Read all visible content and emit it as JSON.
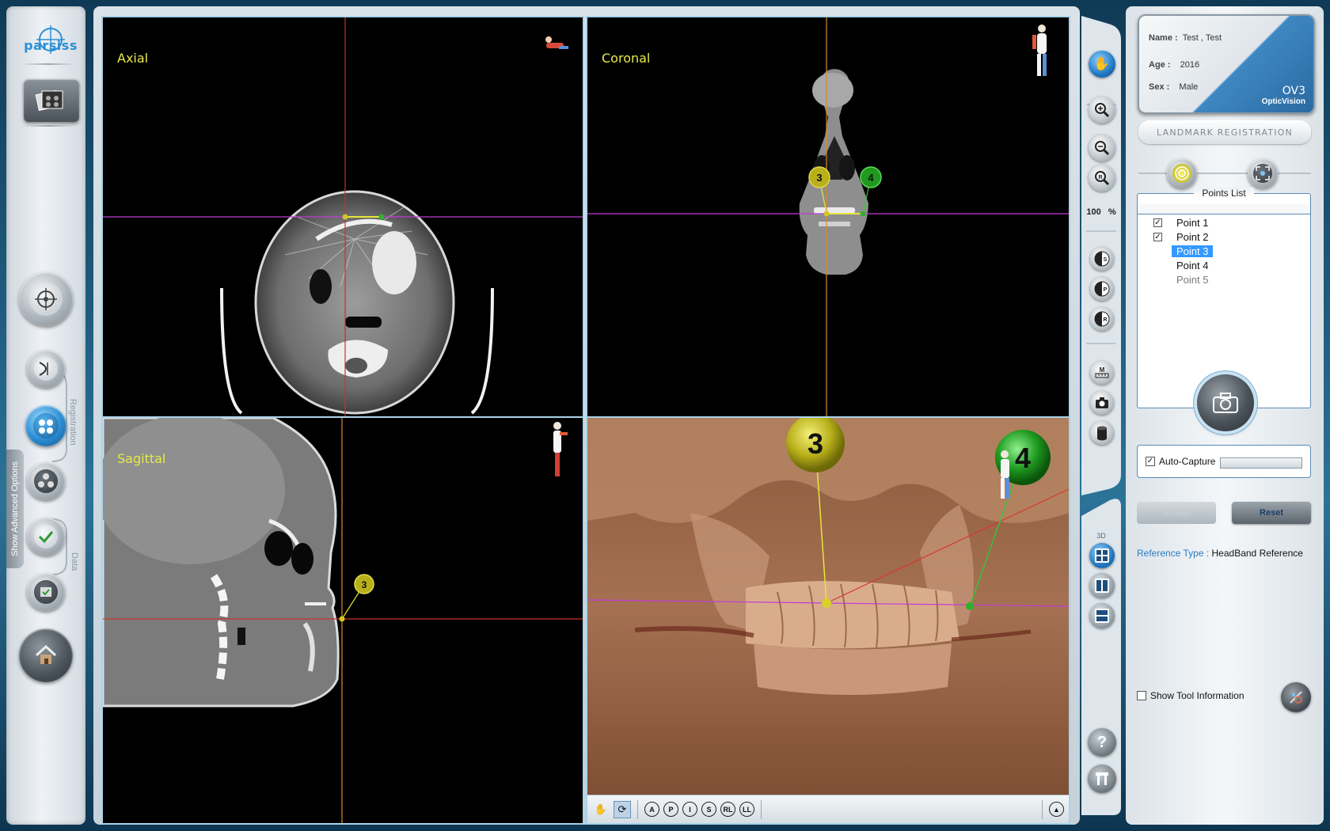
{
  "app": {
    "logo_text": "parsiss"
  },
  "sidebar": {
    "show_advanced_label": "Show Advanced Options",
    "registration_label": "Registration",
    "data_label": "Data"
  },
  "views": {
    "axial": {
      "label": "Axial"
    },
    "coronal": {
      "label": "Coronal"
    },
    "sagittal": {
      "label": "Sagittal"
    },
    "three_d": {
      "label": "3D"
    }
  },
  "landmarks": {
    "coronal": [
      "3",
      "4"
    ],
    "sagittal": [
      "3"
    ],
    "three_d": [
      "3",
      "4"
    ]
  },
  "view3d_toolbar": {
    "buttons": [
      "A",
      "P",
      "I",
      "S",
      "RL",
      "LL"
    ]
  },
  "toolbar": {
    "zoom_value": "100",
    "zoom_unit": "%",
    "contrast_buttons": [
      "S",
      "P",
      "R"
    ],
    "measure_label": "M",
    "layout_label": "3D"
  },
  "patient": {
    "name_label": "Name :",
    "name_value": "Test  , Test",
    "age_label": "Age :",
    "age_value": "2016",
    "sex_label": "Sex :",
    "sex_value": "Male",
    "brand_big": "OV3",
    "brand_small": "OpticVision"
  },
  "registration": {
    "header": "LANDMARK REGISTRATION",
    "points_title": "Points List",
    "points": [
      {
        "label": "Point 1",
        "checked": true,
        "state": "normal"
      },
      {
        "label": "Point 2",
        "checked": true,
        "state": "normal"
      },
      {
        "label": "Point 3",
        "checked": false,
        "state": "selected"
      },
      {
        "label": "Point 4",
        "checked": false,
        "state": "normal"
      },
      {
        "label": "Point 5",
        "checked": false,
        "state": "dim"
      }
    ],
    "auto_capture_label": "Auto-Capture",
    "auto_capture_checked": true,
    "accept_label": "Accept",
    "reset_label": "Reset",
    "reference_type_label": "Reference Type :",
    "reference_type_value": "HeadBand Reference",
    "show_tool_info_label": "Show Tool Information"
  },
  "colors": {
    "crosshair_axial": "#c8332b",
    "crosshair_orange": "#d98a2b",
    "crosshair_magenta": "#c23ad6",
    "landmark_yellow": "#c9c21a",
    "landmark_green": "#26a323",
    "view_label": "#e8e84a",
    "accent_blue": "#2a7bc4"
  }
}
